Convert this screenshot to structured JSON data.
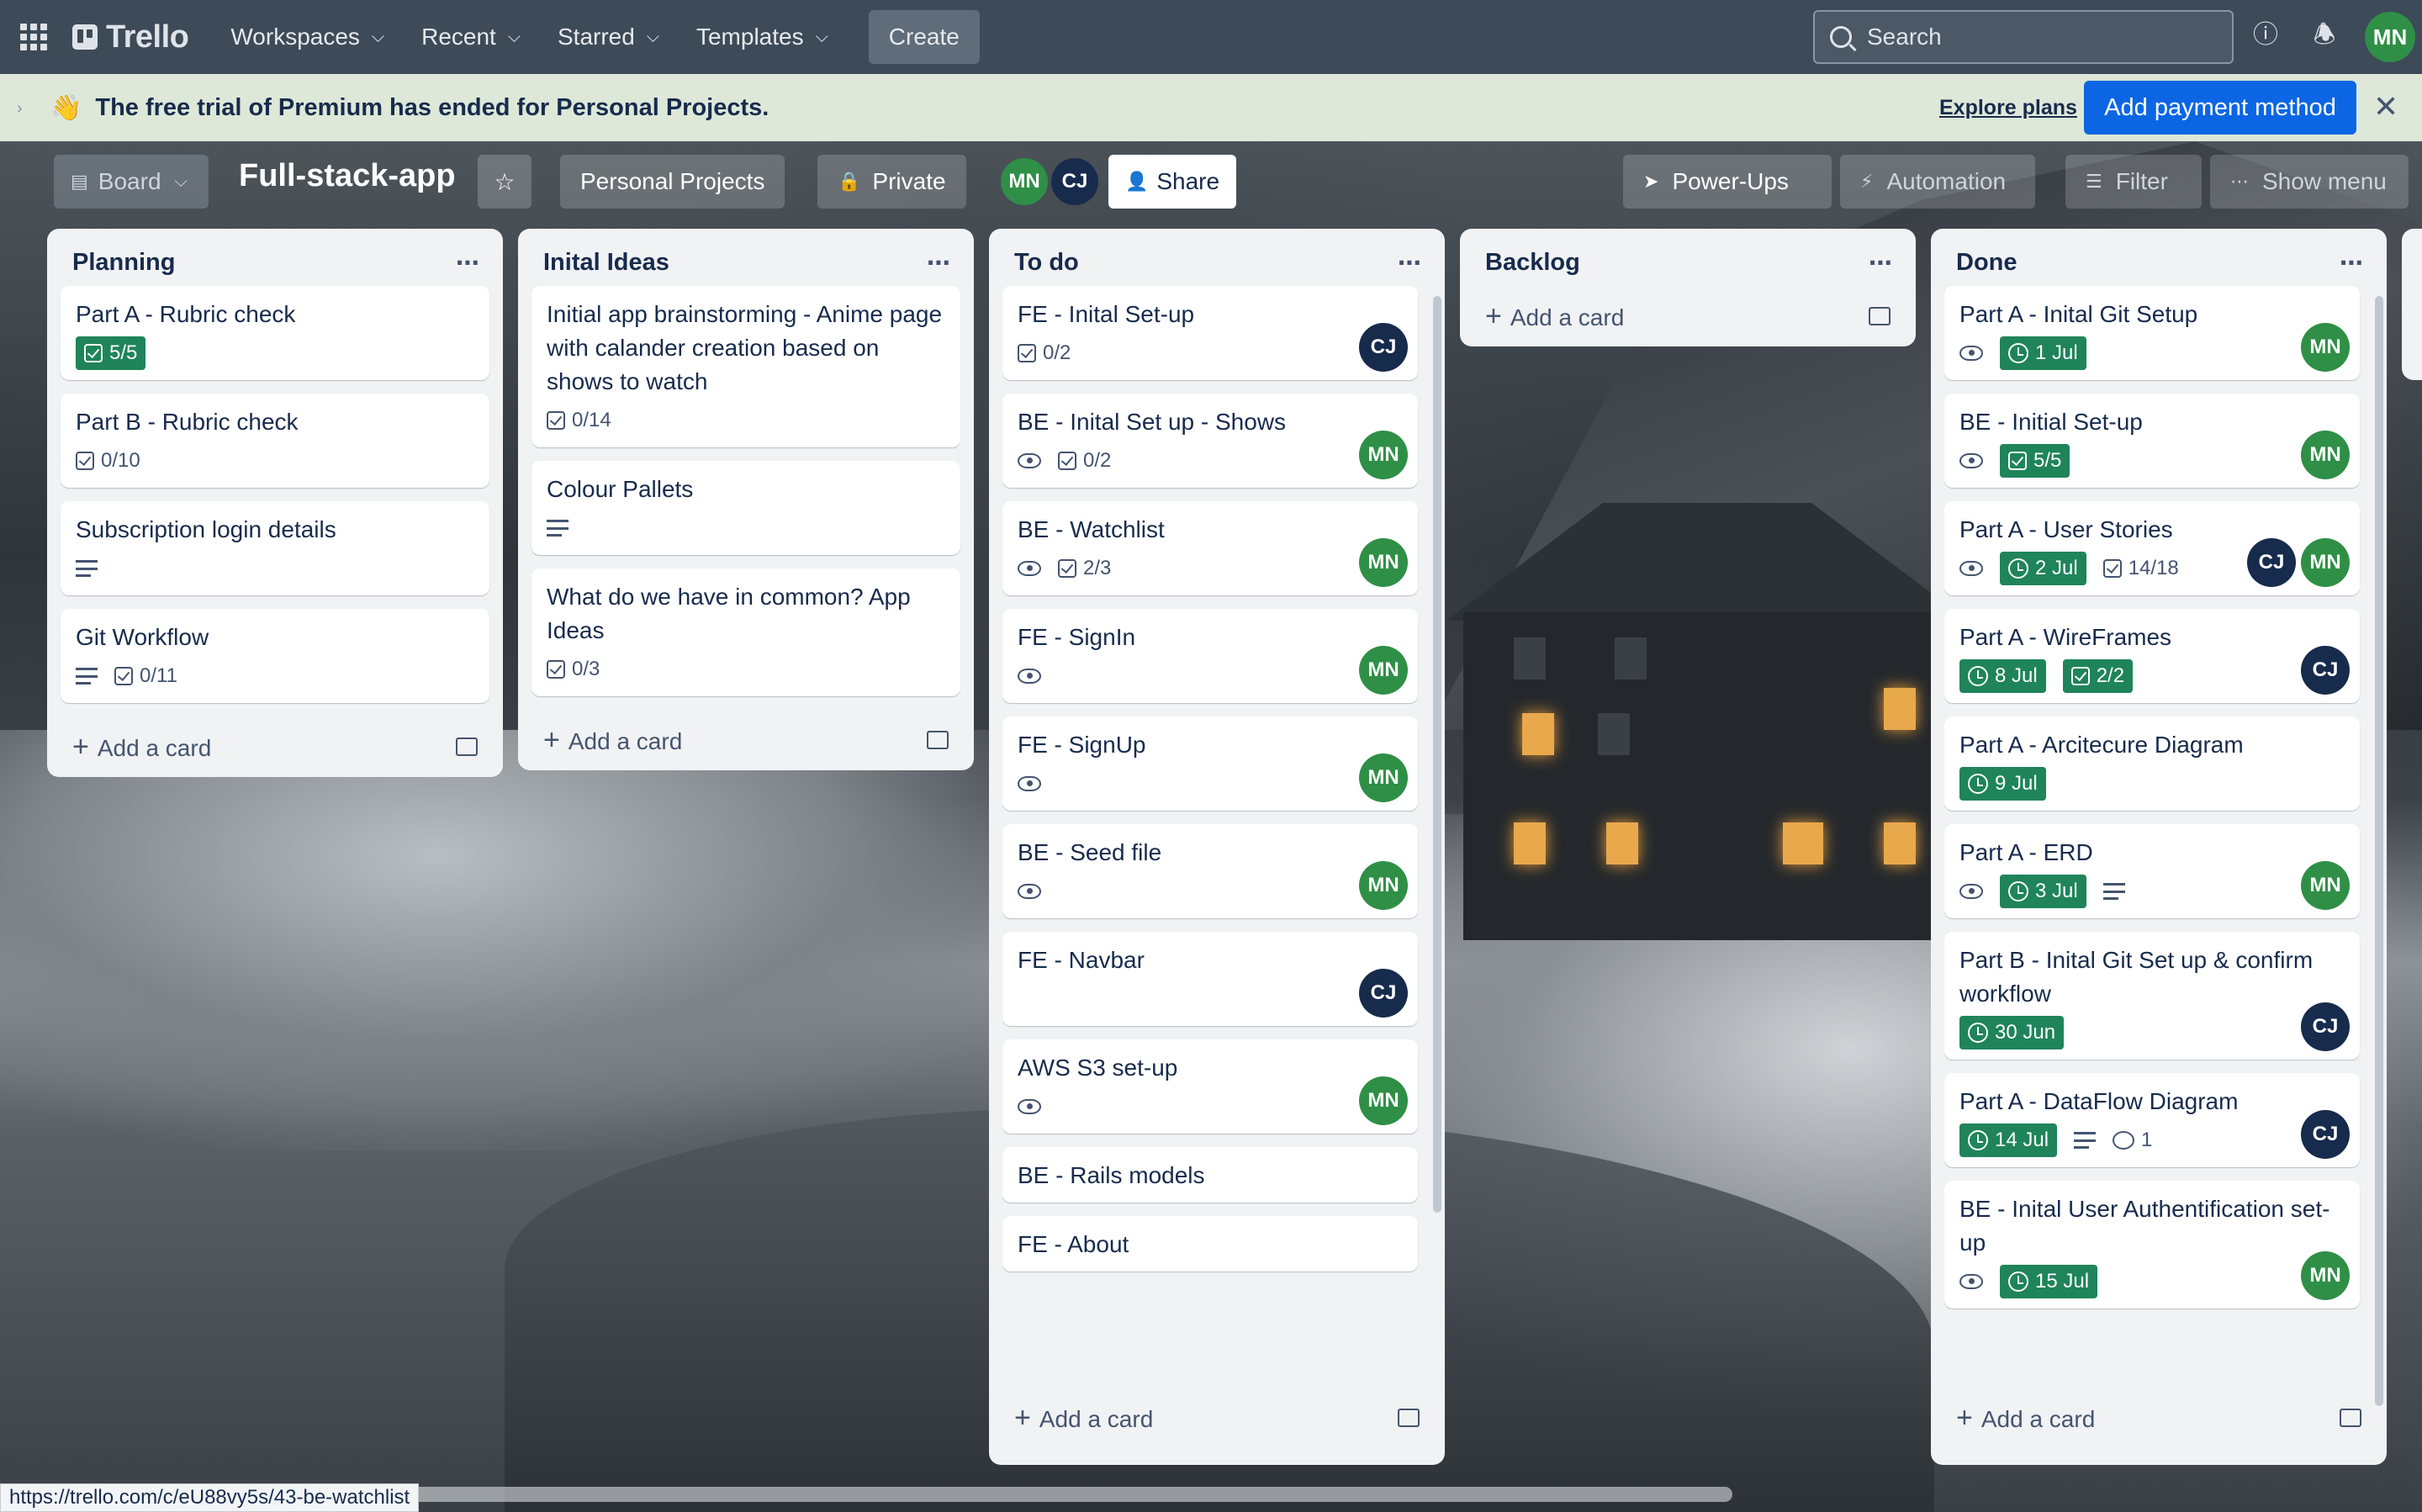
{
  "topbar": {
    "logo": "Trello",
    "nav": [
      {
        "label": "Workspaces"
      },
      {
        "label": "Recent"
      },
      {
        "label": "Starred"
      },
      {
        "label": "Templates"
      }
    ],
    "create": "Create",
    "search_placeholder": "Search",
    "user_initials": "MN"
  },
  "banner": {
    "emoji": "👋",
    "message": "The free trial of Premium has ended for Personal Projects.",
    "explore": "Explore plans",
    "pay": "Add payment method"
  },
  "board_header": {
    "view": "Board",
    "title": "Full-stack-app",
    "workspace": "Personal Projects",
    "visibility": "Private",
    "members": [
      "MN",
      "CJ"
    ],
    "share": "Share",
    "powerups": "Power-Ups",
    "automation": "Automation",
    "filter": "Filter",
    "show_menu": "Show menu"
  },
  "add_card_label": "Add a card",
  "lists": [
    {
      "title": "Planning",
      "cards": [
        {
          "title": "Part A - Rubric check",
          "checklist": "5/5",
          "checklist_done": true
        },
        {
          "title": "Part B - Rubric check",
          "checklist": "0/10"
        },
        {
          "title": "Subscription login details",
          "description": true
        },
        {
          "title": "Git Workflow",
          "description": true,
          "checklist": "0/11"
        }
      ]
    },
    {
      "title": "Inital Ideas",
      "cards": [
        {
          "title": "Initial app brainstorming - Anime page with calander creation based on shows to watch",
          "checklist": "0/14"
        },
        {
          "title": "Colour Pallets",
          "description": true
        },
        {
          "title": "What do we have in common? App Ideas",
          "checklist": "0/3"
        }
      ]
    },
    {
      "title": "To do",
      "cards": [
        {
          "title": "FE - Inital Set-up",
          "checklist": "0/2",
          "members": [
            "CJ"
          ]
        },
        {
          "title": "BE - Inital Set up - Shows",
          "watch": true,
          "checklist": "0/2",
          "members": [
            "MN"
          ]
        },
        {
          "title": "BE - Watchlist",
          "watch": true,
          "checklist": "2/3",
          "members": [
            "MN"
          ]
        },
        {
          "title": "FE - SignIn",
          "watch": true,
          "members": [
            "MN"
          ]
        },
        {
          "title": "FE - SignUp",
          "watch": true,
          "members": [
            "MN"
          ]
        },
        {
          "title": "BE - Seed file",
          "watch": true,
          "members": [
            "MN"
          ]
        },
        {
          "title": "FE - Navbar",
          "members": [
            "CJ"
          ]
        },
        {
          "title": "AWS S3 set-up",
          "watch": true,
          "members": [
            "MN"
          ]
        },
        {
          "title": "BE - Rails models"
        },
        {
          "title": "FE - About"
        }
      ]
    },
    {
      "title": "Backlog",
      "cards": []
    },
    {
      "title": "Done",
      "cards": [
        {
          "title": "Part A - Inital Git Setup",
          "watch": true,
          "date": "1 Jul",
          "members": [
            "MN"
          ]
        },
        {
          "title": "BE - Initial Set-up",
          "watch": true,
          "checklist": "5/5",
          "checklist_done": true,
          "members": [
            "MN"
          ]
        },
        {
          "title": "Part A - User Stories",
          "watch": true,
          "date": "2 Jul",
          "checklist": "14/18",
          "members": [
            "CJ",
            "MN"
          ]
        },
        {
          "title": "Part A - WireFrames",
          "date": "8 Jul",
          "checklist": "2/2",
          "checklist_done": true,
          "members": [
            "CJ"
          ]
        },
        {
          "title": "Part A - Arcitecure Diagram",
          "date": "9 Jul"
        },
        {
          "title": "Part A - ERD",
          "watch": true,
          "date": "3 Jul",
          "description": true,
          "members": [
            "MN"
          ]
        },
        {
          "title": "Part B - Inital Git Set up & confirm workflow",
          "date": "30 Jun",
          "members": [
            "CJ"
          ]
        },
        {
          "title": "Part A - DataFlow Diagram",
          "date": "14 Jul",
          "description": true,
          "comments": "1",
          "members": [
            "CJ"
          ]
        },
        {
          "title": "BE - Inital User Authentification set-up",
          "watch": true,
          "date": "15 Jul",
          "members": [
            "MN"
          ]
        }
      ]
    }
  ],
  "status_url": "https://trello.com/c/eU88vy5s/43-be-watchlist",
  "colors": {
    "topbar": "#3d4a58",
    "banner": "#dde8d8",
    "primary": "#0c66e4",
    "badge_green": "#1f845a",
    "member_mn": "#2f8f46",
    "member_cj": "#172b4d"
  }
}
